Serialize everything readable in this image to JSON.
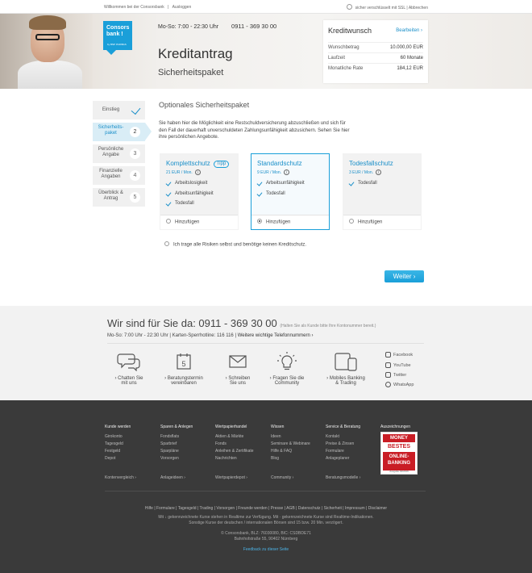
{
  "topbar": {
    "welcome": "Willkommen bei der Consorsbank",
    "logout": "Ausloggen",
    "ssl": "sicher verschlüsselt mit SSL",
    "cancel": "Abbrechen"
  },
  "hero": {
    "logo_line1": "Consors",
    "logo_line2": "bank !",
    "logo_sub": "by BNP PARIBAS",
    "hours": "Mo-So: 7:00 - 22:30 Uhr",
    "phone": "0911 - 369 30 00",
    "title": "Kreditantrag",
    "subtitle": "Sicherheitspaket"
  },
  "kreditwunsch": {
    "title": "Kreditwunsch",
    "edit": "Bearbeiten",
    "rows": [
      {
        "label": "Wunschbetrag",
        "value": "10.000,00 EUR"
      },
      {
        "label": "Laufzeit",
        "value": "60 Monate"
      },
      {
        "label": "Monatliche Rate",
        "value": "184,12 EUR"
      }
    ]
  },
  "steps": [
    {
      "label": "Einstieg",
      "num": ""
    },
    {
      "label": "Sicherheits-\npaket",
      "num": "2"
    },
    {
      "label": "Persönliche\nAngabe",
      "num": "3"
    },
    {
      "label": "Finanzielle\nAngaben",
      "num": "4"
    },
    {
      "label": "Überblick &\nAntrag",
      "num": "5"
    }
  ],
  "content": {
    "title": "Optionales Sicherheitspaket",
    "intro": "Sie haben hier die Möglichkeit eine Restschuldversicherung abzuschließen und sich für den Fall der dauerhaft unverschuldeten Zahlungsunfähigkeit abzusichern. Sehen Sie hier ihre persönlichen Angebote.",
    "cards": [
      {
        "title": "Komplettschutz",
        "tag": "Tipp",
        "price": "21 EUR / Mon.",
        "items": [
          "Arbeitslosigkeit",
          "Arbeitsunfähigkeit",
          "Todesfall"
        ],
        "add": "Hinzufügen",
        "selected": false
      },
      {
        "title": "Standardschutz",
        "tag": "",
        "price": "9 EUR / Mon.",
        "items": [
          "Arbeitsunfähigkeit",
          "Todesfall"
        ],
        "add": "Hinzufügen",
        "selected": true
      },
      {
        "title": "Todesfallschutz",
        "tag": "",
        "price": "3 EUR / Mon.",
        "items": [
          "Todesfall"
        ],
        "add": "Hinzufügen",
        "selected": false
      }
    ],
    "no_risk": "Ich trage alle Risiken selbst und benötige keinen Kreditschutz.",
    "next": "Weiter"
  },
  "contact": {
    "title": "Wir sind für Sie da: 0911 - 369 30 00",
    "title_note": "(Halten Sie als Kunde bitte Ihre Kontonummer bereit.)",
    "line_hours": "Mo-So: 7:00 Uhr - 22:30 Uhr",
    "line_hotline": "Karten-Sperrhotline: 116 116",
    "line_more": "Weitere wichtige Telefonnummern",
    "items": [
      {
        "l1": "Chatten Sie",
        "l2": "mit uns"
      },
      {
        "l1": "Beratungstermin",
        "l2": "vereinbaren"
      },
      {
        "l1": "Schreiben",
        "l2": "Sie uns"
      },
      {
        "l1": "Fragen Sie die",
        "l2": "Community"
      },
      {
        "l1": "Mobiles Banking",
        "l2": "& Trading"
      }
    ],
    "calendar_day": "5",
    "social": [
      "Facebook",
      "YouTube",
      "Twitter",
      "WhatsApp"
    ]
  },
  "footer": {
    "cols": [
      {
        "head": "Kunde werden",
        "items": [
          "Girokonto",
          "Tagesgeld",
          "Festgeld",
          "Depot"
        ],
        "more": "Kontenvergleich"
      },
      {
        "head": "Sparen & Anlegen",
        "items": [
          "Fondsflats",
          "Sparbrief",
          "Sparpläne",
          "Vorsorgen"
        ],
        "more": "Anlageideen"
      },
      {
        "head": "Wertpapierhandel",
        "items": [
          "Aktien & Märkte",
          "Fonds",
          "Anleihen & Zertifikate",
          "Nachrichten"
        ],
        "more": "Wertpapierdepot"
      },
      {
        "head": "Wissen",
        "items": [
          "Ideen",
          "Seminare & Webinare",
          "Hilfe & FAQ",
          "Blog"
        ],
        "more": "Community"
      },
      {
        "head": "Service & Beratung",
        "items": [
          "Kontakt",
          "Preise & Zinsen",
          "Formulare",
          "Anlageplaner"
        ],
        "more": "Beratungsmodelle"
      },
      {
        "head": "Auszeichnungen",
        "items": [],
        "more": ""
      }
    ],
    "award": {
      "brand": "MONEY",
      "l1": "BESTES",
      "l2": "ONLINE-",
      "l3": "BANKING",
      "small": "Ausgabe 02/2016"
    },
    "links": "Hilfe | Formulare | Tagesgeld | Trading | Vorsorgen | Freunde werden | Presse | AGB | Datenschutz | Sicherheit | Impressum | Disclaimer",
    "note1": "Mit ↓ gekennzeichnete Kurse stehen in Realtime zur Verfügung. Mit · gekennzeichnete Kurse sind Realtime-Indikationen.",
    "note2": "Sonstige Kurse der deutschen / internationalen Börsen sind 15 bzw. 20 Min. verzögert.",
    "addr1": "© Consorsbank, BLZ: 76030080, BIC: CSDBDE71",
    "addr2": "Bahnhofstraße 55, 90402 Nürnberg",
    "feedback": "Feedback zu dieser Seite"
  }
}
